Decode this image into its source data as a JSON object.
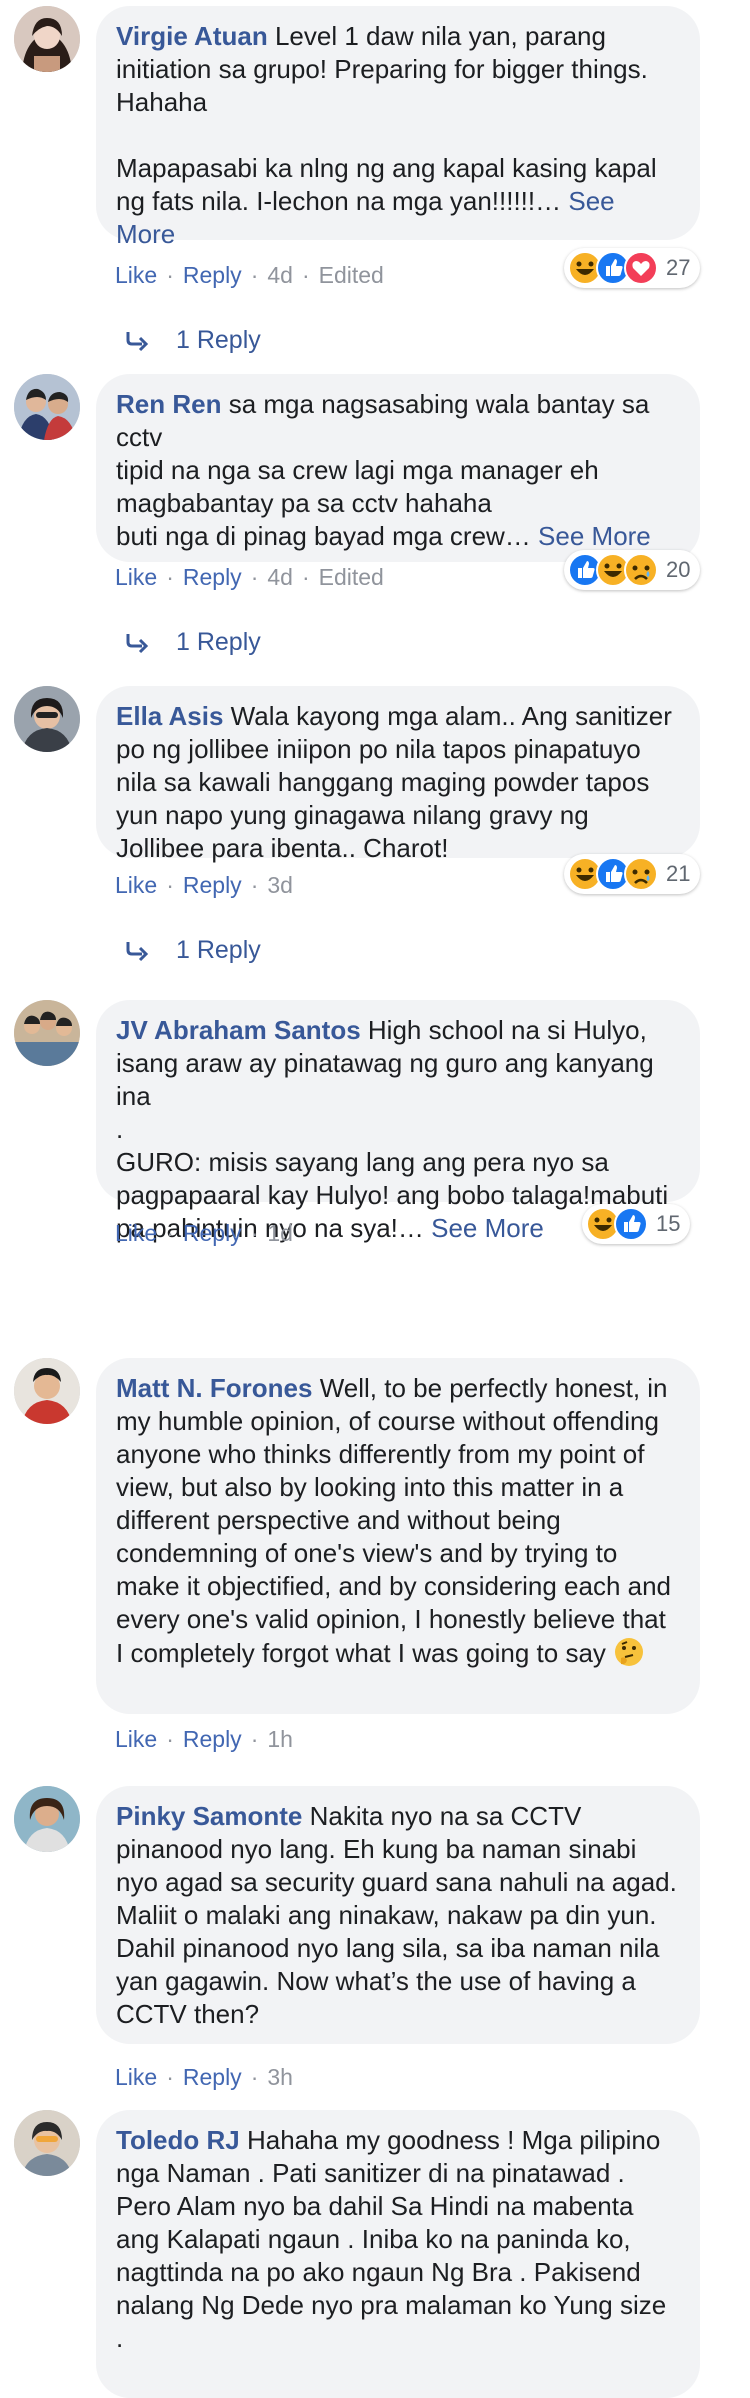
{
  "labels": {
    "like": "Like",
    "reply": "Reply",
    "dot": "·",
    "see_more": "See More"
  },
  "comments": [
    {
      "author": "Virgie Atuan",
      "paragraphs": [
        "Level 1 daw nila yan, parang initiation sa grupo! Preparing for bigger things. Hahaha",
        "Mapapasabi ka nlng ng ang kapal kasing kapal ng fats nila. I-lechon na mga yan!!!!!!…"
      ],
      "time": "4d",
      "edited": "Edited",
      "reaction_icons": [
        "haha-icon",
        "like-icon",
        "love-icon"
      ],
      "reaction_count": "27",
      "replies": "1 Reply"
    },
    {
      "author": "Ren Ren",
      "paragraphs": [
        "sa mga nagsasabing wala bantay sa cctv\ntipid na nga sa crew lagi mga manager eh magbabantay pa sa cctv hahaha\nbuti nga di pinag bayad mga crew…"
      ],
      "time": "4d",
      "edited": "Edited",
      "reaction_icons": [
        "like-icon",
        "haha-icon",
        "sad-icon"
      ],
      "reaction_count": "20",
      "replies": "1 Reply"
    },
    {
      "author": "Ella Asis",
      "paragraphs": [
        "Wala kayong mga alam.. Ang sanitizer po ng jollibee iniipon po nila tapos pinapatuyo nila sa kawali hanggang maging powder tapos yun napo yung ginagawa nilang gravy ng Jollibee para ibenta.. Charot!"
      ],
      "time": "3d",
      "reaction_icons": [
        "haha-icon",
        "like-icon",
        "sad-icon"
      ],
      "reaction_count": "21",
      "replies": "1 Reply"
    },
    {
      "author": "JV Abraham Santos",
      "paragraphs": [
        "High school na si Hulyo, isang araw ay pinatawag ng guro ang kanyang ina\n.\nGURO: misis sayang lang ang pera nyo sa pagpapaaral kay Hulyo! ang bobo talaga!mabuti pa pahintuin nyo na sya!…"
      ],
      "time": "1d",
      "reaction_icons": [
        "haha-icon",
        "like-icon"
      ],
      "reaction_count": "15"
    },
    {
      "author": "Matt N. Forones",
      "paragraphs": [
        "Well, to be perfectly honest, in my humble opinion, of course without offending anyone who thinks differently from my point of view, but also by looking into this matter in a different perspective and without being condemning of one's view's and by trying to make it objectified, and by considering each and every one's valid opinion, I honestly believe that I completely forgot what I was going to say"
      ],
      "trailing_emoji": "thinking-face-icon",
      "time": "1h"
    },
    {
      "author": "Pinky Samonte",
      "paragraphs": [
        "Nakita nyo na sa CCTV pinanood nyo lang. Eh kung ba naman sinabi nyo agad sa security guard sana nahuli na agad. Maliit o malaki ang ninakaw, nakaw pa din yun. Dahil pinanood nyo lang sila, sa iba naman nila yan gagawin. Now what’s the use of having a CCTV then?"
      ],
      "time": "3h"
    },
    {
      "author": "Toledo RJ",
      "paragraphs": [
        "Hahaha my goodness ! Mga pilipino nga Naman . Pati sanitizer di na pinatawad . Pero Alam nyo ba dahil Sa Hindi na mabenta ang Kalapati ngaun . Iniba ko na paninda ko, nagttinda na po ako ngaun Ng Bra . Pakisend nalang Ng Dede nyo pra malaman ko Yung size ."
      ]
    }
  ],
  "colors": {
    "link": "#385898",
    "meta": "#90949c",
    "bubble": "#f2f3f5"
  }
}
